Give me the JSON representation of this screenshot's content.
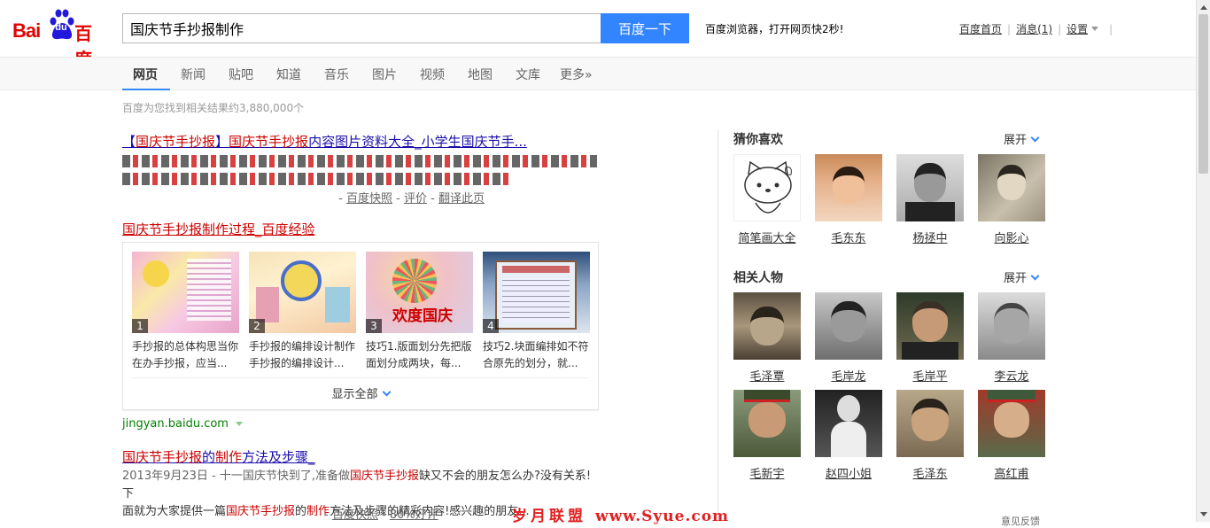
{
  "header": {
    "logo_bai": "Bai",
    "logo_du": "du",
    "logo_cn": "百度",
    "search_value": "国庆节手抄报制作",
    "search_button": "百度一下",
    "promo": "百度浏览器，打开网页快2秒!",
    "links": {
      "home": "百度首页",
      "messages": "消息(1)",
      "settings": "设置"
    }
  },
  "tabs": [
    "网页",
    "新闻",
    "贴吧",
    "知道",
    "音乐",
    "图片",
    "视频",
    "地图",
    "文库",
    "更多»"
  ],
  "result_count": "百度为您找到相关结果约3,880,000个",
  "results": {
    "r1": {
      "title_a": "【",
      "title_b": "国庆节手抄报",
      "title_c": "】",
      "title_d": "国庆节手抄报",
      "title_e": "内容图片资料大全_小学生国庆节手...",
      "tail": "国庆节手抄报...",
      "snapshot": "百度快照",
      "review": "评价",
      "translate": "翻译此页"
    },
    "r2": {
      "title": "国庆节手抄报制作过程_百度经验",
      "items": [
        {
          "num": "1",
          "text": "手抄报的总体构思当你在办手抄报，应当..."
        },
        {
          "num": "2",
          "text": "手抄报的编排设计制作手抄报的编排设计..."
        },
        {
          "num": "3",
          "text": "技巧1.版面划分先把版面划分成两块，每..."
        },
        {
          "num": "4",
          "text": "技巧2.块面编排如不符合原先的划分，就..."
        }
      ],
      "show_all": "显示全部",
      "url": "jingyan.baidu.com"
    },
    "r3": {
      "title_a": "国庆节手抄报",
      "title_b": "的",
      "title_c": "制作",
      "title_d": "方法及步骤_",
      "line1_a": "2013年9月23日 - 十一国庆节快到了,准备做",
      "line1_b": "国庆节手抄报",
      "line1_c": "缺又不会的朋友怎么办?没有关系!下",
      "line2_a": "面就为大家提供一篇",
      "line2_b": "国庆节手抄报",
      "line2_c": "的",
      "line2_d": "制作",
      "line2_e": "方法及步骤的精彩内容!感兴趣的朋友...",
      "snapshot": "百度快照",
      "rating": "80%好评"
    }
  },
  "right": {
    "guess_title": "猜你喜欢",
    "expand": "展开",
    "guess": [
      "简笔画大全",
      "毛东东",
      "杨拯中",
      "向影心"
    ],
    "related_title": "相关人物",
    "related": [
      "毛泽覃",
      "毛岸龙",
      "毛岸平",
      "李云龙",
      "毛新宇",
      "赵四小姐",
      "毛泽东",
      "高红甫"
    ],
    "cut": "意见反馈"
  },
  "watermark": {
    "cn": "岁月联盟",
    "url": "www.Syue.com"
  },
  "colors": {
    "accent": "#3385ff",
    "brand_red": "#e10602",
    "link": "#1a0dab",
    "highlight": "#cc0000",
    "url_green": "#008000"
  }
}
